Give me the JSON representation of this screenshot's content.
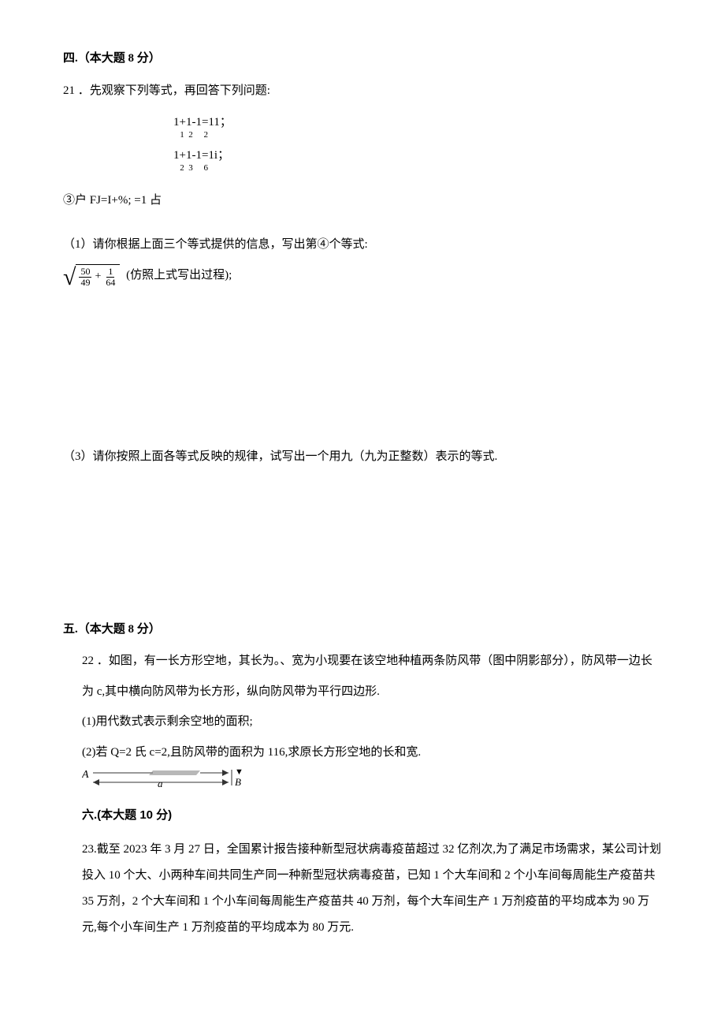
{
  "section4": {
    "header": "四.（本大题 8 分）",
    "q21_intro": "21 ．先观察下列等式，再回答下列问题:",
    "eq1_line": "1+1-1=11；",
    "eq1_sub": "   1  2     2",
    "eq2_line": "1+1-1=1i；",
    "eq2_sub": "   2  3     6",
    "eq3_line": "③户 FJ=I+%; =1 占",
    "sub1": "（1）请你根据上面三个等式提供的信息，写出第④个等式:",
    "formula_frac1_num": "50",
    "formula_frac1_den": "49",
    "formula_plus": "+",
    "formula_frac2_num": "1",
    "formula_frac2_den": "64",
    "formula_tail": "(仿照上式写出过程);",
    "sub3": "（3）请你按照上面各等式反映的规律，试写出一个用九（九为正整数）表示的等式."
  },
  "section5": {
    "header": "五.（本大题 8 分）",
    "q22_l1": "22 ．如图，有一长方形空地，其长为。、宽为小现要在该空地种植两条防风带（图中阴影部分），防风带一边长",
    "q22_l2": "为 c,其中横向防风带为长方形，纵向防风带为平行四边形.",
    "q22_s1": "(1)用代数式表示剩余空地的面积;",
    "q22_s2": "(2)若 Q=2 氏 c=2,且防风带的面积为 116,求原长方形空地的长和宽.",
    "diagram": {
      "A": "A",
      "a": "a",
      "B": "B",
      "arrow": "▼"
    }
  },
  "section6": {
    "header": "六.(本大题 10 分)",
    "q23": "23.截至 2023 年 3 月 27 日，全国累计报告接种新型冠状病毒疫苗超过 32 亿剂次,为了满足市场需求，某公司计划投入 10 个大、小两种车间共同生产同一种新型冠状病毒疫苗，已知 1 个大车间和 2 个小车间每周能生产疫苗共 35 万剂，2 个大车间和 1 个小车间每周能生产疫苗共 40 万剂，每个大车间生产 1 万剂疫苗的平均成本为 90 万元,每个小车间生产 1 万剂疫苗的平均成本为 80 万元."
  }
}
